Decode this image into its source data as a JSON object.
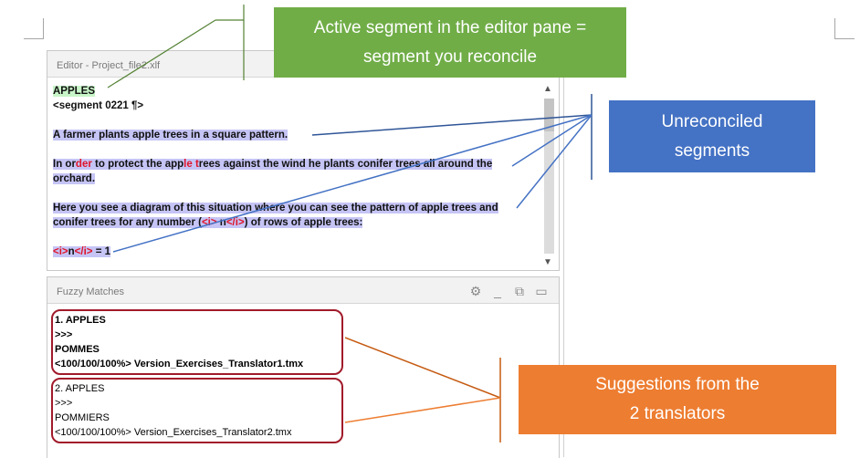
{
  "editor": {
    "title": "Editor - Project_file2.xlf",
    "source_heading": "APPLES",
    "segment_tag": "<segment 0221 ¶>",
    "paragraph1": "A farmer plants apple trees in a square pattern.",
    "p2_part1": "In or",
    "p2_part2": "der",
    "p2_part3": " to protect the app",
    "p2_part4": "le",
    "p2_part5": " ",
    "p2_part6": "t",
    "p2_part7": "rees against the wind he plants conifer trees all around the",
    "p2_line2": "orchard.",
    "p3_line1": "Here you see a diagram of this situation where you can see the pattern of apple trees and",
    "p3_line2_a": "conifer trees for any number (",
    "p3_line2_b": "<i>",
    "p3_line2_c": " n",
    "p3_line2_d": "</i>",
    "p3_line2_e": ") of rows of apple trees:",
    "p4_a": "<i>",
    "p4_b": "n",
    "p4_c": "</i>",
    "p4_d": " = 1"
  },
  "fuzzy": {
    "title": "Fuzzy Matches",
    "item1": [
      "1. APPLES",
      ">>>",
      "POMMES",
      "<100/100/100%> Version_Exercises_Translator1.tmx"
    ],
    "item2": [
      "2. APPLES",
      ">>>",
      "POMMIERS",
      "<100/100/100%> Version_Exercises_Translator2.tmx"
    ],
    "icons": [
      "gear-icon",
      "minimize-icon",
      "popout-icon",
      "maximize-icon"
    ]
  },
  "callouts": {
    "active_line1": "Active segment in the editor pane =",
    "active_line2": "segment you reconcile",
    "unreconciled_line1": "Unreconciled",
    "unreconciled_line2": "segments",
    "suggestions_line1": "Suggestions from the",
    "suggestions_line2": "2 translators"
  },
  "colors": {
    "green_callout": "#70ad47",
    "blue_callout": "#4472c4",
    "orange_callout": "#ed7d31",
    "segment_highlight": "#c5c4f5",
    "fuzzy_border": "#a11a2a"
  }
}
